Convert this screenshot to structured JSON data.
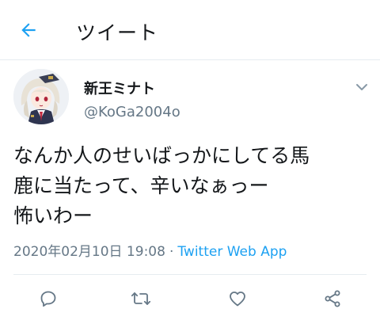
{
  "header": {
    "title": "ツイート",
    "back_icon": "arrow-left-icon"
  },
  "tweet": {
    "display_name": "新王ミナト",
    "handle": "@KoGa2004o",
    "text": "なんか人のせいばっかにしてる馬\n鹿に当たって、辛いなぁっー\n怖いわー",
    "timestamp": "2020年02月10日 19:08",
    "separator": "·",
    "source": "Twitter Web App",
    "more_icon": "chevron-down-icon"
  },
  "actions": {
    "reply_icon": "reply-icon",
    "retweet_icon": "retweet-icon",
    "like_icon": "heart-icon",
    "share_icon": "share-icon"
  },
  "colors": {
    "accent": "#1da1f2",
    "text": "#14171a",
    "secondary": "#657786",
    "border": "#e6ecf0"
  }
}
